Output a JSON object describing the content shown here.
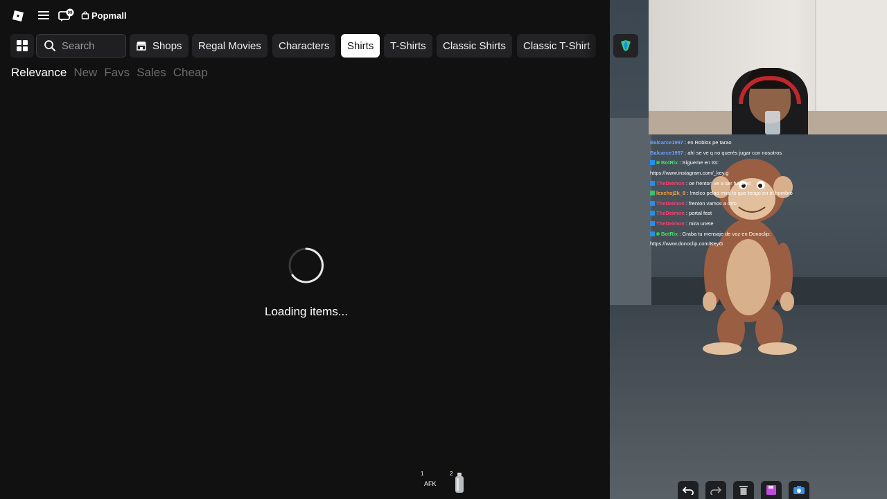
{
  "topbar": {
    "brand": "Popmall",
    "notification_count": "99"
  },
  "filters": {
    "search_placeholder": "Search",
    "chips": [
      "Shops",
      "Regal Movies",
      "Characters",
      "Shirts",
      "T-Shirts",
      "Classic Shirts",
      "Classic T-Shirt"
    ],
    "active_chip": "Shirts"
  },
  "sort": {
    "options": [
      "Relevance",
      "New",
      "Favs",
      "Sales",
      "Cheap"
    ],
    "active": "Relevance"
  },
  "loading": {
    "text": "Loading items..."
  },
  "hotbar": {
    "slots": [
      {
        "number": "1",
        "label": "AFK"
      },
      {
        "number": "2",
        "label": ""
      }
    ]
  },
  "chat": {
    "messages": [
      {
        "user": "Balcarce1997",
        "text": " : en Roblox pe tarao"
      },
      {
        "user": "Balcarce1997",
        "text": " : ahí se ve q no querés jugar con nosotros"
      },
      {
        "user": "BotRix",
        "text": " : Sígueme en IG:"
      },
      {
        "user": "",
        "text": "https://www.instagram.com/_key.g"
      },
      {
        "user": "TheDeimon",
        "text": " : oe frenton ve a ser fut creo"
      },
      {
        "user": "lexchsj2k_8",
        "text": " : !melco pelao mira lo que tengo en el hombro"
      },
      {
        "user": "TheDeimon",
        "text": " : frenton vamos a otro"
      },
      {
        "user": "TheDeimon",
        "text": " : portal fest"
      },
      {
        "user": "TheDeimon",
        "text": " : mira unete"
      },
      {
        "user": "BotRix",
        "text": " : Graba tu mensaje de voz en Donoclip:"
      },
      {
        "user": "",
        "text": "https://www.donoclip.com/KeyG"
      }
    ]
  },
  "colors": {
    "background": "#111112",
    "chip_bg": "#232325",
    "active_chip_bg": "#ffffff",
    "muted_text": "#6a6a6c"
  }
}
